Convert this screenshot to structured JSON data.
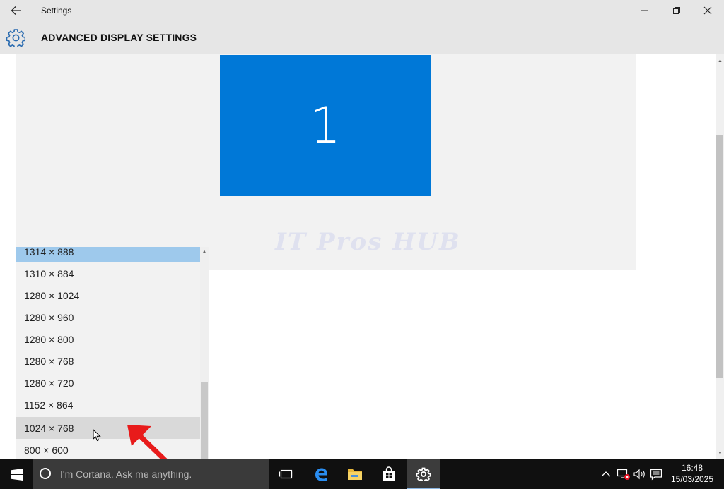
{
  "window": {
    "title": "Settings",
    "page_title": "ADVANCED DISPLAY SETTINGS"
  },
  "display_preview": {
    "monitor_number": "1",
    "watermark": "IT Pros HUB",
    "accent_color": "#0078d7"
  },
  "resolution_dropdown": {
    "options": [
      "1314 × 888",
      "1310 × 884",
      "1280 × 1024",
      "1280 × 960",
      "1280 × 800",
      "1280 × 768",
      "1280 × 720",
      "1152 × 864",
      "1024 × 768",
      "800 × 600"
    ],
    "selected": "1314 × 888",
    "hovered": "1024 × 768"
  },
  "taskbar": {
    "search_placeholder": "I'm Cortana. Ask me anything.",
    "pinned": [
      "task-view-icon",
      "edge-icon",
      "file-explorer-icon",
      "store-icon",
      "settings-icon"
    ],
    "tray": [
      "show-hidden-icons-icon",
      "network-error-icon",
      "volume-icon",
      "action-center-icon"
    ],
    "time": "16:48",
    "date": "15/03/2025"
  }
}
